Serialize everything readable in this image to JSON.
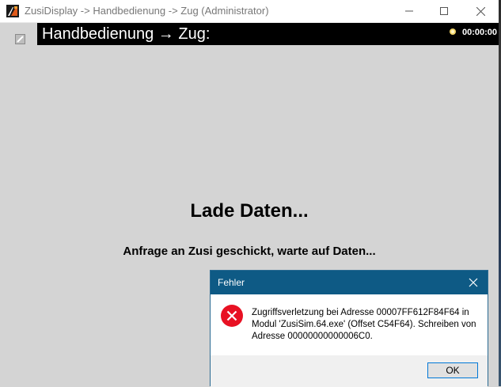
{
  "window": {
    "title": "ZusiDisplay -> Handbedienung -> Zug (Administrator)",
    "icon": "zusi-app-icon"
  },
  "header": {
    "title": "Handbedienung → Zug:",
    "clock": "00:00:00",
    "clock_icon": "sun-icon"
  },
  "main": {
    "loading_title": "Lade Daten...",
    "loading_subtitle": "Anfrage an Zusi geschickt, warte auf Daten..."
  },
  "dialog": {
    "title": "Fehler",
    "message": "Zugriffsverletzung bei Adresse 00007FF612F84F64 in Modul 'ZusiSim.64.exe' (Offset C54F64). Schreiben von Adresse 00000000000006C0.",
    "ok_label": "OK",
    "icon": "error-icon"
  },
  "colors": {
    "background": "#d4d4d4",
    "header_bar": "#000000",
    "dialog_titlebar": "#0e5a85",
    "error_red": "#e81123",
    "button_focus": "#0078d7"
  }
}
